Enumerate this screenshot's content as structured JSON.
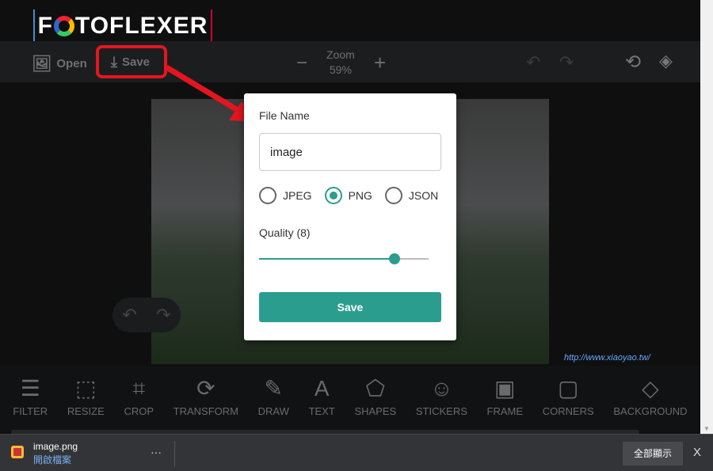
{
  "app": {
    "logo": "FOTOFLEXER"
  },
  "toolbar": {
    "open": "Open",
    "save": "Save",
    "zoom_label": "Zoom",
    "zoom_value": "59%",
    "zoom_out": "−",
    "zoom_in": "+"
  },
  "dialog": {
    "file_name_label": "File Name",
    "file_name_value": "image",
    "formats": [
      "JPEG",
      "PNG",
      "JSON"
    ],
    "selected_format": "PNG",
    "quality_label": "Quality (8)",
    "quality_value": 8,
    "quality_max": 10,
    "save_label": "Save",
    "accent": "#2a9d8f"
  },
  "tools": [
    {
      "label": "FILTER",
      "icon": "sliders-icon"
    },
    {
      "label": "RESIZE",
      "icon": "resize-icon"
    },
    {
      "label": "CROP",
      "icon": "crop-icon"
    },
    {
      "label": "TRANSFORM",
      "icon": "rotate-icon"
    },
    {
      "label": "DRAW",
      "icon": "pencil-icon"
    },
    {
      "label": "TEXT",
      "icon": "text-add-icon"
    },
    {
      "label": "SHAPES",
      "icon": "shapes-icon"
    },
    {
      "label": "STICKERS",
      "icon": "smiley-icon"
    },
    {
      "label": "FRAME",
      "icon": "frame-icon"
    },
    {
      "label": "CORNERS",
      "icon": "rounded-rect-icon"
    },
    {
      "label": "BACKGROUND",
      "icon": "paint-bucket-icon"
    }
  ],
  "download": {
    "file": "image.png",
    "open_link": "開啟檔案",
    "more": "···",
    "show_all": "全部顯示",
    "close": "X"
  },
  "watermark": "http://www.xiaoyao.tw/"
}
